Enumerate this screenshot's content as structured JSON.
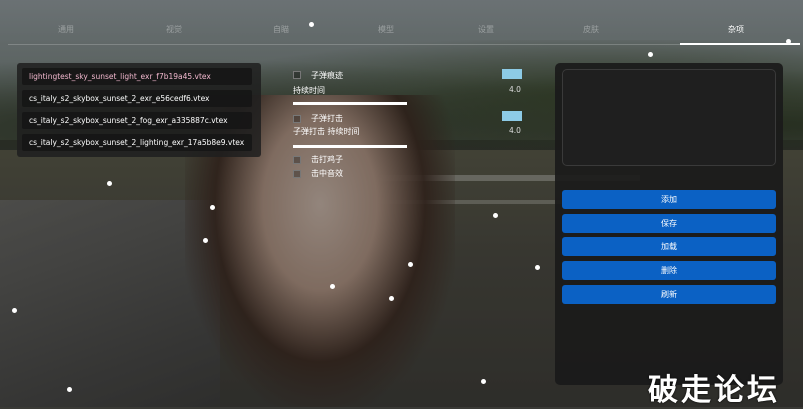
{
  "tabs": [
    {
      "label": "通用"
    },
    {
      "label": "视觉"
    },
    {
      "label": "自瞄"
    },
    {
      "label": "模型"
    },
    {
      "label": "设置"
    },
    {
      "label": "皮肤"
    },
    {
      "label": "杂项"
    }
  ],
  "active_tab": "杂项",
  "files": [
    {
      "label": "lightingtest_sky_sunset_light_exr_f7b19a45.vtex",
      "selected": true
    },
    {
      "label": "cs_italy_s2_skybox_sunset_2_exr_e56cedf6.vtex",
      "selected": false
    },
    {
      "label": "cs_italy_s2_skybox_sunset_2_fog_exr_a335887c.vtex",
      "selected": false
    },
    {
      "label": "cs_italy_s2_skybox_sunset_2_lighting_exr_17a5b8e9.vtex",
      "selected": false
    }
  ],
  "controls": {
    "bullet_trail": {
      "label": "子弹痕迹",
      "color": "#8dcbe6"
    },
    "duration": {
      "label": "持续时间",
      "value": "4.0"
    },
    "bullet_hit": {
      "label": "子弹打击",
      "color": "#8dcbe6"
    },
    "hit_duration": {
      "label": "子弹打击 持续时间",
      "value": "4.0"
    },
    "hit_chicken": {
      "label": "击打鸡子"
    },
    "hit_sound": {
      "label": "击中音效"
    }
  },
  "buttons": {
    "add": "添加",
    "save": "保存",
    "load": "加载",
    "delete": "删除",
    "refresh": "刷新"
  },
  "watermark": "破走论坛",
  "colors": {
    "accent": "#0b61c4",
    "selected_text": "#f3b9cf",
    "swatch": "#8dcbe6"
  }
}
